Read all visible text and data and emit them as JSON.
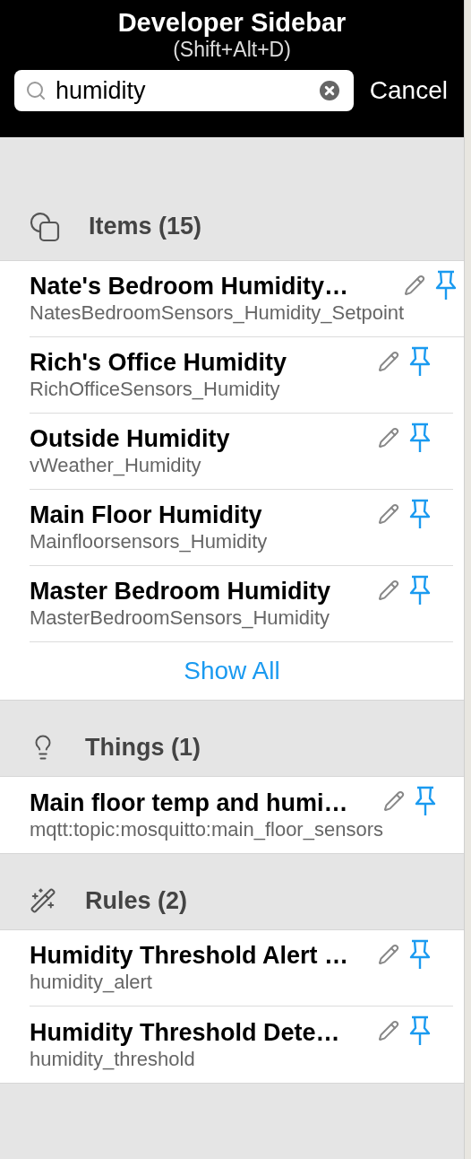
{
  "header": {
    "title": "Developer Sidebar",
    "shortcut": "(Shift+Alt+D)"
  },
  "search": {
    "value": "humidity",
    "cancel": "Cancel"
  },
  "sections": [
    {
      "kind": "items",
      "title": "Items (15)",
      "rows": [
        {
          "title": "Nate's Bedroom Humidity…",
          "subtitle": "NatesBedroomSensors_Humidity_Setpoint"
        },
        {
          "title": "Rich's Office Humidity",
          "subtitle": "RichOfficeSensors_Humidity"
        },
        {
          "title": "Outside Humidity",
          "subtitle": "vWeather_Humidity"
        },
        {
          "title": "Main Floor Humidity",
          "subtitle": "Mainfloorsensors_Humidity"
        },
        {
          "title": "Master Bedroom Humidity",
          "subtitle": "MasterBedroomSensors_Humidity"
        }
      ],
      "show_all": "Show All"
    },
    {
      "kind": "things",
      "title": "Things (1)",
      "rows": [
        {
          "title": "Main floor temp and humi…",
          "subtitle": "mqtt:topic:mosquitto:main_floor_sensors"
        }
      ]
    },
    {
      "kind": "rules",
      "title": "Rules (2)",
      "rows": [
        {
          "title": "Humidity Threshold Alert …",
          "subtitle": "humidity_alert"
        },
        {
          "title": "Humidity Threshold Dete…",
          "subtitle": "humidity_threshold"
        }
      ]
    }
  ]
}
